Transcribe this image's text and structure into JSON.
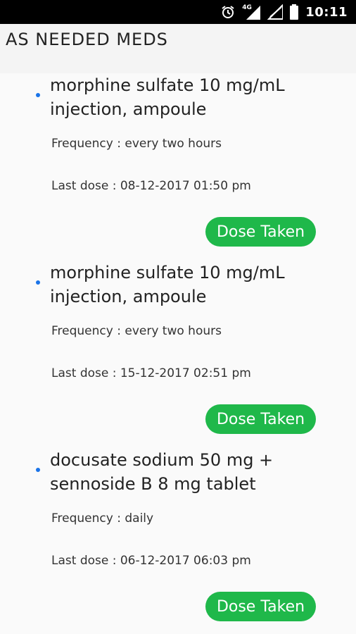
{
  "status_bar": {
    "alarm_icon": "alarm-clock-icon",
    "network_label": "4G",
    "time": "10:11",
    "icons": [
      "alarm-clock-icon",
      "4g-signal-icon",
      "signal-icon",
      "no-signal-icon",
      "battery-icon"
    ]
  },
  "header": {
    "title": "AS NEEDED MEDS"
  },
  "meds": [
    {
      "name": "morphine sulfate 10 mg/mL injection, ampoule",
      "frequency": "Frequency : every two hours",
      "last_dose": "Last dose : 08-12-2017 01:50 pm",
      "button_label": "Dose Taken"
    },
    {
      "name": "morphine sulfate 10 mg/mL injection, ampoule",
      "frequency": "Frequency : every two hours",
      "last_dose": "Last dose : 15-12-2017 02:51 pm",
      "button_label": "Dose Taken"
    },
    {
      "name": "docusate sodium 50 mg + sennoside B 8 mg tablet",
      "frequency": "Frequency : daily",
      "last_dose": "Last dose : 06-12-2017 06:03 pm",
      "button_label": "Dose Taken"
    }
  ],
  "colors": {
    "accent_button": "#1fb84a",
    "bullet": "#1a73e8",
    "status_bar": "#000000"
  }
}
